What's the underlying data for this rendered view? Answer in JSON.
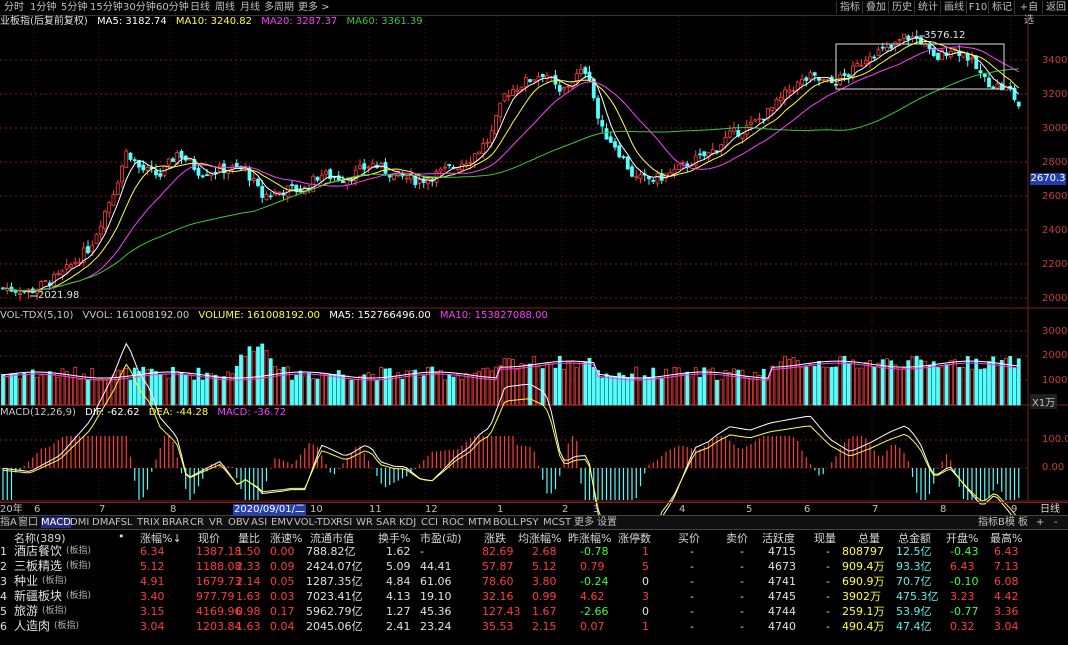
{
  "colors": {
    "up": "#ff3c3c",
    "down": "#54ffff",
    "ma5": "#ffffff",
    "ma10": "#ffff3c",
    "ma20": "#ff3cff",
    "ma60": "#3cc83c",
    "bg": "#000000",
    "grid": "#7a1e1e"
  },
  "toolbar": {
    "periods": [
      "分时",
      "1分钟",
      "5分钟",
      "15分钟",
      "30分钟",
      "60分钟",
      "日线",
      "周线",
      "月线",
      "多周期",
      "更多 >"
    ],
    "right_tabs": [
      "指标",
      "叠加",
      "历史",
      "统计",
      "画线",
      "F10",
      "标记",
      "+自选",
      "返回"
    ]
  },
  "main_chart": {
    "title": "业板指(后复前复权)",
    "ma": [
      {
        "label": "MA5: 3182.74",
        "color": "#ffffff"
      },
      {
        "label": "MA10: 3240.82",
        "color": "#ffff3c"
      },
      {
        "label": "MA20: 3287.37",
        "color": "#ff3cff"
      },
      {
        "label": "MA60: 3361.39",
        "color": "#3cc83c"
      }
    ],
    "y_ticks": [
      "3400",
      "3200",
      "3000",
      "2800",
      "2600",
      "2400",
      "2200",
      "2000"
    ],
    "high_mark": "3576.12",
    "low_mark": "2021.98",
    "last_price": "2670.3"
  },
  "volume_chart": {
    "title": "VOL-TDX(5,10)",
    "items": [
      {
        "label": "VVOL: 161008192.00",
        "color": "#c8c8c8"
      },
      {
        "label": "VOLUME: 161008192.00",
        "color": "#ffff3c"
      },
      {
        "label": "MA5: 152766496.00",
        "color": "#ffffff"
      },
      {
        "label": "MA10: 153827088.00",
        "color": "#ff3cff"
      }
    ],
    "y_ticks": [
      "30000",
      "20000",
      "10000"
    ],
    "unit": "X1万"
  },
  "macd_chart": {
    "title": "MACD(12,26,9)",
    "items": [
      {
        "label": "DIF: -62.62",
        "color": "#ffffff"
      },
      {
        "label": "DEA: -44.28",
        "color": "#ffff3c"
      },
      {
        "label": "MACD: -36.72",
        "color": "#ff3cff"
      }
    ],
    "y_ticks": [
      "100.00",
      "0.00"
    ]
  },
  "date_axis": {
    "labels": [
      "20年",
      "6",
      "7",
      "8",
      "2020/09/01/二",
      "10",
      "11",
      "12",
      "1",
      "2",
      "3",
      "4",
      "5",
      "6",
      "7",
      "8",
      "9"
    ],
    "period": "日线"
  },
  "indicator_tabs": [
    "指A",
    "窗口",
    "MACD",
    "DMI",
    "DMA",
    "FSL",
    "TRIX",
    "BRAR",
    "CR",
    "VR",
    "OBV",
    "ASI",
    "EMV",
    "VOL-TDX",
    "RSI",
    "WR",
    "SAR",
    "KDJ",
    "CCI",
    "ROC",
    "MTM",
    "BOLL",
    "PSY",
    "MCST",
    "更多",
    "设置"
  ],
  "indicator_right": [
    "指标B",
    "模",
    "板",
    "+",
    "-"
  ],
  "table": {
    "headers": [
      "名称(389)",
      "•",
      "涨幅%↓",
      "现价",
      "量比",
      "涨速%",
      "流通市值",
      "换手%",
      "市盈(动)",
      "涨跌",
      "均涨幅%",
      "昨涨幅%",
      "涨停数",
      "买价",
      "卖价",
      "活跃度",
      "现量",
      "总量",
      "总金额",
      "开盘%",
      "最高%"
    ],
    "rows": [
      {
        "idx": "1",
        "name": "酒店餐饮",
        "tag": "(板指)",
        "chg": "6.34",
        "price": "1387.18",
        "vr": "1.50",
        "spd": "0.00",
        "mcap": "788.82亿",
        "turn": "1.62",
        "pe": "-",
        "diff": "82.69",
        "avg": "2.68",
        "yest": "-0.78",
        "lim": "1",
        "bid": "-",
        "ask": "-",
        "act": "4715",
        "cur": "-",
        "vol": "808797",
        "amt": "12.5亿",
        "open": "-0.43",
        "high": "6.43"
      },
      {
        "idx": "2",
        "name": "三板精选",
        "tag": "(板指)",
        "chg": "5.12",
        "price": "1188.08",
        "vr": "2.33",
        "spd": "0.09",
        "mcap": "2424.07亿",
        "turn": "5.09",
        "pe": "44.41",
        "diff": "57.87",
        "avg": "5.12",
        "yest": "0.79",
        "lim": "5",
        "bid": "-",
        "ask": "-",
        "act": "4673",
        "cur": "-",
        "vol": "909.4万",
        "amt": "93.3亿",
        "open": "6.43",
        "high": "7.13"
      },
      {
        "idx": "3",
        "name": "种业",
        "tag": "(板指)",
        "chg": "4.91",
        "price": "1679.73",
        "vr": "2.14",
        "spd": "0.05",
        "mcap": "1287.35亿",
        "turn": "4.84",
        "pe": "61.06",
        "diff": "78.60",
        "avg": "3.80",
        "yest": "-0.24",
        "lim": "0",
        "bid": "-",
        "ask": "-",
        "act": "4741",
        "cur": "-",
        "vol": "690.9万",
        "amt": "70.7亿",
        "open": "-0.10",
        "high": "6.08"
      },
      {
        "idx": "4",
        "name": "新疆板块",
        "tag": "(板指)",
        "chg": "3.40",
        "price": "977.79",
        "vr": "1.63",
        "spd": "0.03",
        "mcap": "7023.41亿",
        "turn": "4.13",
        "pe": "19.10",
        "diff": "32.16",
        "avg": "0.99",
        "yest": "4.62",
        "lim": "3",
        "bid": "-",
        "ask": "-",
        "act": "4745",
        "cur": "-",
        "vol": "3902万",
        "amt": "475.3亿",
        "open": "3.23",
        "high": "4.42"
      },
      {
        "idx": "5",
        "name": "旅游",
        "tag": "(板指)",
        "chg": "3.15",
        "price": "4169.96",
        "vr": "0.98",
        "spd": "0.17",
        "mcap": "5962.79亿",
        "turn": "1.27",
        "pe": "45.36",
        "diff": "127.43",
        "avg": "1.67",
        "yest": "-2.66",
        "lim": "0",
        "bid": "-",
        "ask": "-",
        "act": "4744",
        "cur": "-",
        "vol": "259.1万",
        "amt": "53.9亿",
        "open": "-0.77",
        "high": "3.36"
      },
      {
        "idx": "6",
        "name": "人造肉",
        "tag": "(板指)",
        "chg": "3.04",
        "price": "1203.84",
        "vr": "1.63",
        "spd": "0.04",
        "mcap": "2045.06亿",
        "turn": "2.41",
        "pe": "23.24",
        "diff": "35.53",
        "avg": "2.15",
        "yest": "0.07",
        "lim": "1",
        "bid": "-",
        "ask": "-",
        "act": "4740",
        "cur": "-",
        "vol": "490.4万",
        "amt": "47.4亿",
        "open": "0.32",
        "high": "3.04"
      }
    ]
  }
}
